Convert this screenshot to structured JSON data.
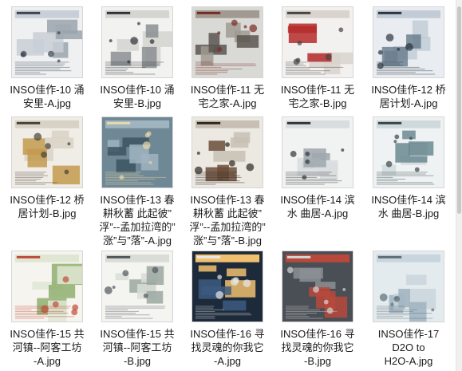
{
  "files": [
    {
      "lines": [
        "INSO佳作-10 涌",
        "安里-A.jpg"
      ],
      "icon": "image-thumbnail-icon"
    },
    {
      "lines": [
        "INSO佳作-10 涌",
        "安里-B.jpg"
      ],
      "icon": "image-thumbnail-icon"
    },
    {
      "lines": [
        "INSO佳作-11 无",
        "宅之家-A.jpg"
      ],
      "icon": "image-thumbnail-icon"
    },
    {
      "lines": [
        "INSO佳作-11 无",
        "宅之家-B.jpg"
      ],
      "icon": "image-thumbnail-icon"
    },
    {
      "lines": [
        "INSO佳作-12 桥",
        "居计划-A.jpg"
      ],
      "icon": "image-thumbnail-icon"
    },
    {
      "lines": [
        "INSO佳作-12 桥",
        "居计划-B.jpg"
      ],
      "icon": "image-thumbnail-icon"
    },
    {
      "lines": [
        "INSO佳作-13 春",
        "耕秋蓄 此起彼”",
        "浮”--孟加拉湾的”",
        "涨”与”落”-A.jpg"
      ],
      "icon": "image-thumbnail-icon"
    },
    {
      "lines": [
        "INSO佳作-13 春",
        "耕秋蓄 此起彼”",
        "浮”--孟加拉湾的”",
        "涨”与”落”-B.jpg"
      ],
      "icon": "image-thumbnail-icon"
    },
    {
      "lines": [
        "INSO佳作-14 滨",
        "水 曲居-A.jpg"
      ],
      "icon": "image-thumbnail-icon"
    },
    {
      "lines": [
        "INSO佳作-14 滨",
        "水 曲居-B.jpg"
      ],
      "icon": "image-thumbnail-icon"
    },
    {
      "lines": [
        "INSO佳作-15 共",
        "河镇--阿客工坊",
        "-A.jpg"
      ],
      "icon": "image-thumbnail-icon"
    },
    {
      "lines": [
        "INSO佳作-15 共",
        "河镇--阿客工坊",
        "-B.jpg"
      ],
      "icon": "image-thumbnail-icon"
    },
    {
      "lines": [
        "INSO佳作-16 寻",
        "找灵魂的你我它",
        "-A.jpg"
      ],
      "icon": "image-thumbnail-icon"
    },
    {
      "lines": [
        "INSO佳作-16 寻",
        "找灵魂的你我它",
        "-B.jpg"
      ],
      "icon": "image-thumbnail-icon"
    },
    {
      "lines": [
        "INSO佳作-17",
        "D2O to",
        "H2O-A.jpg"
      ],
      "icon": "image-thumbnail-icon"
    }
  ]
}
